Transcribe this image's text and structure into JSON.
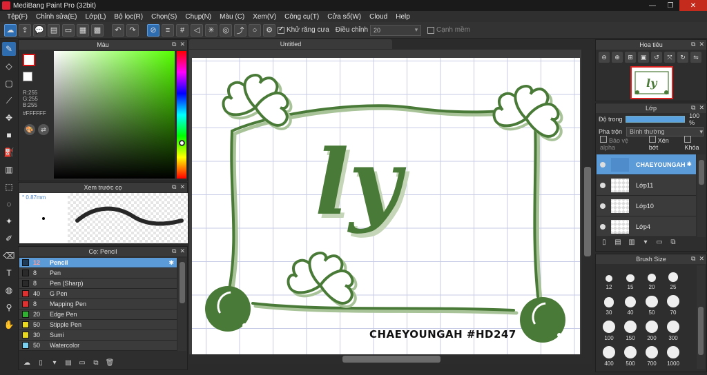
{
  "window": {
    "title": "MediBang Paint Pro (32bit)"
  },
  "menu": [
    "Tệp(F)",
    "Chỉnh sửa(E)",
    "Lớp(L)",
    "Bộ lọc(R)",
    "Chọn(S)",
    "Chụp(N)",
    "Màu (C)",
    "Xem(V)",
    "Công cụ(T)",
    "Cửa sổ(W)",
    "Cloud",
    "Help"
  ],
  "toolbar": {
    "antialias_label": "Khử răng cưa",
    "adjust_label": "Điều chỉnh",
    "adjust_value": "20",
    "edge_label": "Cạnh mềm"
  },
  "color_panel": {
    "title": "Màu",
    "r": "R:255",
    "g": "G:255",
    "b": "B:255",
    "hex": "#FFFFFF"
  },
  "preview_panel": {
    "title": "Xem trước cọ",
    "size": "0.87mm"
  },
  "brush_panel": {
    "title": "Cọ: Pencil",
    "brushes": [
      {
        "size": "12",
        "name": "Pencil",
        "color": "#1f3b5a",
        "selected": true
      },
      {
        "size": "8",
        "name": "Pen",
        "color": "#2a2a2a"
      },
      {
        "size": "8",
        "name": "Pen (Sharp)",
        "color": "#2a2a2a"
      },
      {
        "size": "40",
        "name": "G Pen",
        "color": "#e03030"
      },
      {
        "size": "8",
        "name": "Mapping Pen",
        "color": "#e03030"
      },
      {
        "size": "20",
        "name": "Edge Pen",
        "color": "#30b030"
      },
      {
        "size": "50",
        "name": "Stipple Pen",
        "color": "#e8d820"
      },
      {
        "size": "30",
        "name": "Sumi",
        "color": "#e8d820"
      },
      {
        "size": "50",
        "name": "Watercolor",
        "color": "#7ad0f0"
      }
    ]
  },
  "document": {
    "tab": "Untitled",
    "text_ly": "ly",
    "watermark": "CHAEYOUNGAH #HD247",
    "art_color": "#4a7a37"
  },
  "navigator": {
    "title": "Hoa tiêu"
  },
  "layer_panel": {
    "title": "Lớp",
    "opacity_label": "Độ trong",
    "opacity_value": "100 %",
    "blend_label": "Pha trộn",
    "blend_value": "Bình thường",
    "protect_alpha": "Bảo vệ alpha",
    "clip": "Xén bớt",
    "lock": "Khóa",
    "layers": [
      {
        "name": "CHAEYOUNGAH",
        "selected": true
      },
      {
        "name": "Lớp11"
      },
      {
        "name": "Lớp10"
      },
      {
        "name": "Lớp4"
      }
    ]
  },
  "brush_size_panel": {
    "title": "Brush Size",
    "sizes": [
      "12",
      "15",
      "20",
      "25",
      "30",
      "40",
      "50",
      "70",
      "100",
      "150",
      "200",
      "300",
      "400",
      "500",
      "700",
      "1000"
    ]
  }
}
